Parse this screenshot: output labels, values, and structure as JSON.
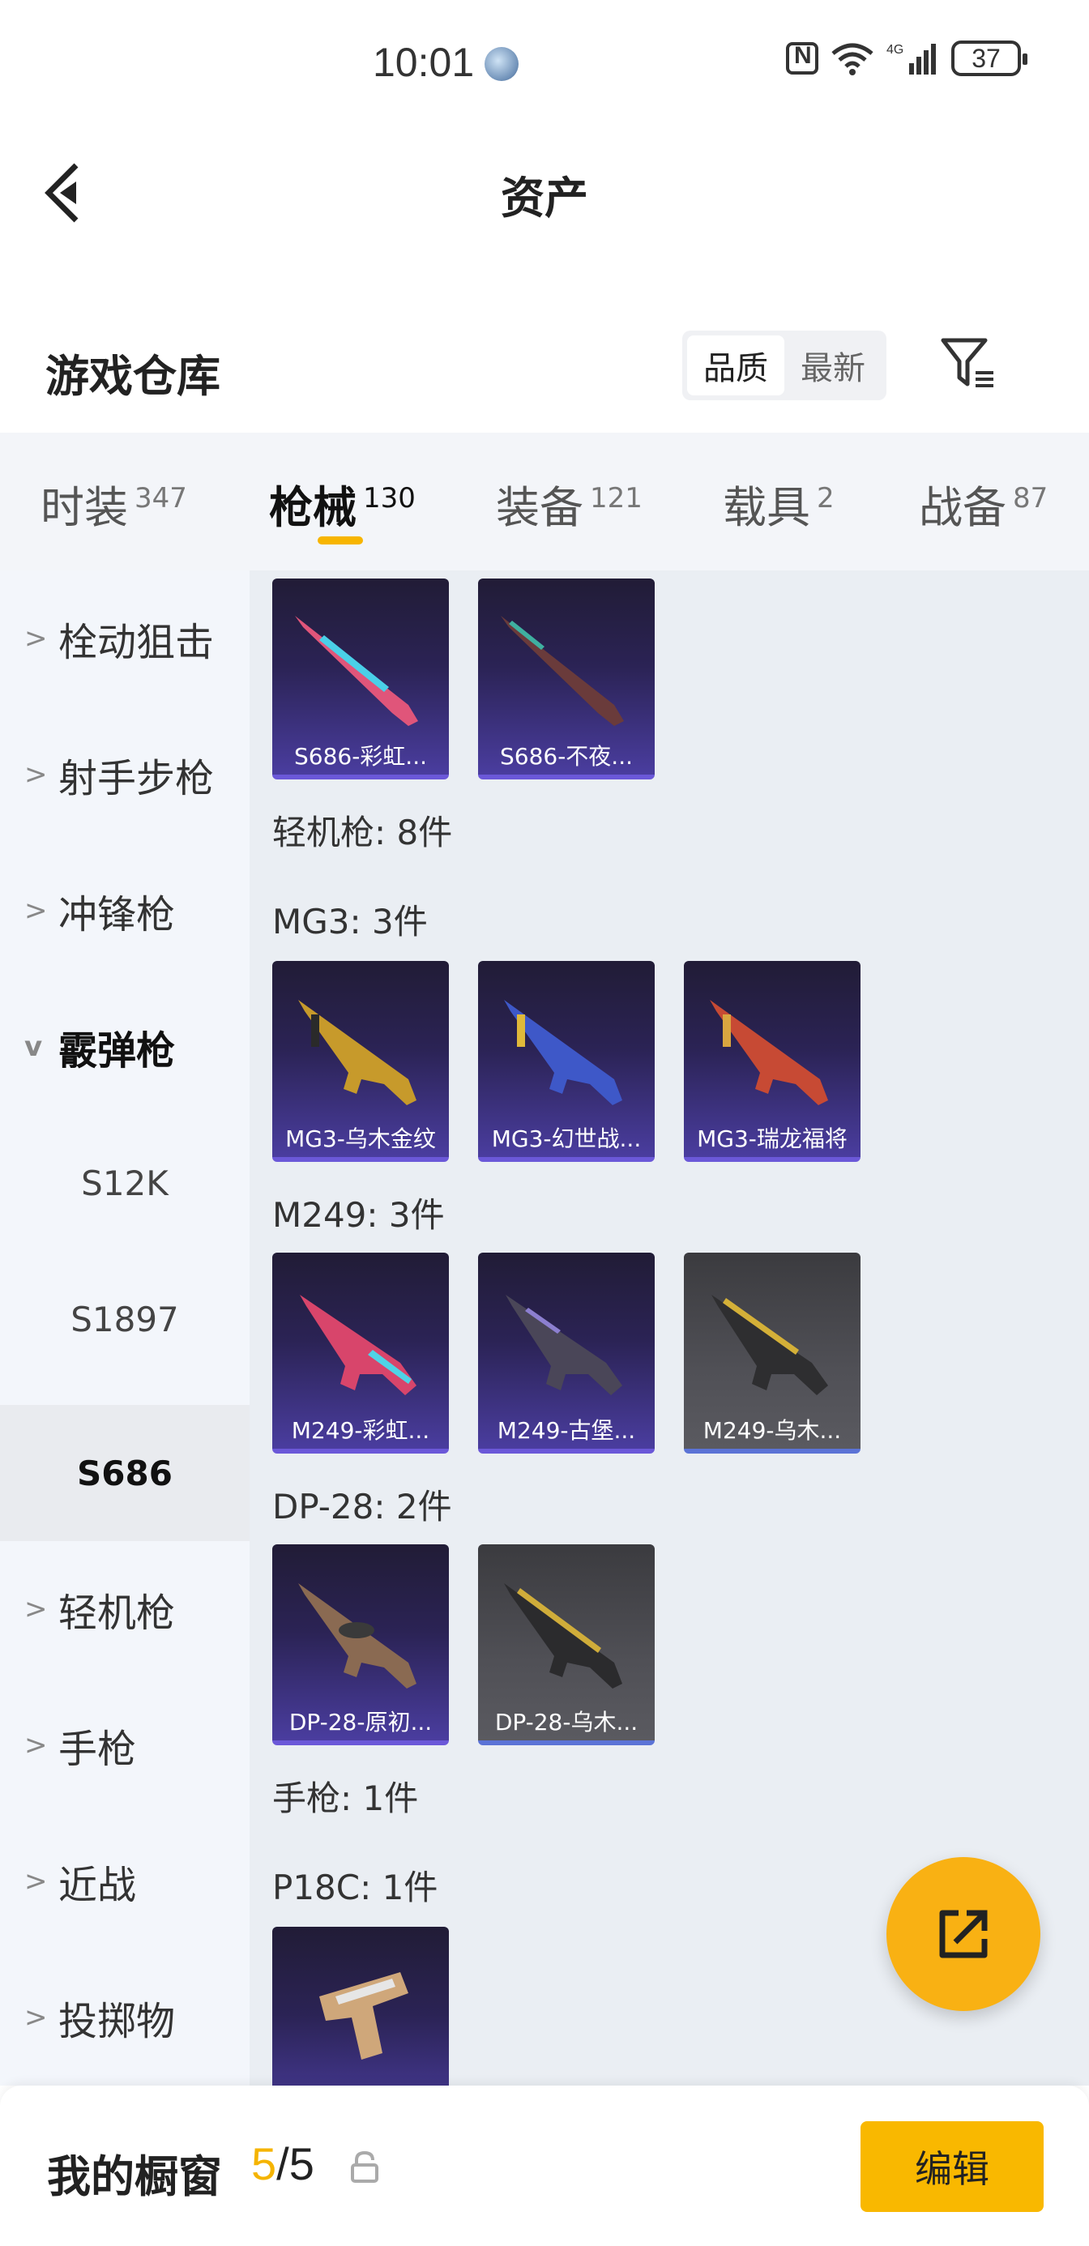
{
  "status_bar": {
    "time": "10:01",
    "network": "4G",
    "wifi_badge": "6",
    "battery": "37"
  },
  "header": {
    "title": "资产"
  },
  "warehouse": {
    "title": "游戏仓库",
    "sort_options": [
      "品质",
      "最新"
    ],
    "active_sort": "品质"
  },
  "tabs": [
    {
      "label": "时装",
      "count": "347"
    },
    {
      "label": "枪械",
      "count": "130"
    },
    {
      "label": "装备",
      "count": "121"
    },
    {
      "label": "载具",
      "count": "2"
    },
    {
      "label": "战备",
      "count": "87"
    }
  ],
  "sidebar": {
    "items": [
      {
        "label": "栓动狙击",
        "chevron": ">"
      },
      {
        "label": "射手步枪",
        "chevron": ">"
      },
      {
        "label": "冲锋枪",
        "chevron": ">"
      },
      {
        "label": "霰弹枪",
        "chevron": "v"
      },
      {
        "label": "S12K"
      },
      {
        "label": "S1897"
      },
      {
        "label": "S686"
      },
      {
        "label": "轻机枪",
        "chevron": ">"
      },
      {
        "label": "手枪",
        "chevron": ">"
      },
      {
        "label": "近战",
        "chevron": ">"
      },
      {
        "label": "投掷物",
        "chevron": ">"
      }
    ]
  },
  "content": {
    "groups": [
      {
        "label": ""
      },
      {
        "label": "轻机枪: 8件"
      },
      {
        "label": "MG3: 3件"
      },
      {
        "label": "M249: 3件"
      },
      {
        "label": "DP-28: 2件"
      },
      {
        "label": "手枪: 1件"
      },
      {
        "label": "P18C: 1件"
      }
    ],
    "cards": [
      {
        "name": "S686-彩虹..."
      },
      {
        "name": "S686-不夜..."
      },
      {
        "name": "MG3-乌木金纹"
      },
      {
        "name": "MG3-幻世战..."
      },
      {
        "name": "MG3-瑞龙福将"
      },
      {
        "name": "M249-彩虹..."
      },
      {
        "name": "M249-古堡..."
      },
      {
        "name": "M249-乌木..."
      },
      {
        "name": "DP-28-原初..."
      },
      {
        "name": "DP-28-乌木..."
      },
      {
        "name": ""
      }
    ]
  },
  "bottom_bar": {
    "label": "我的橱窗",
    "used": "5",
    "total": "/5",
    "edit_label": "编辑"
  },
  "colors": {
    "accent": "#F9B800",
    "card_purple": "#4A3D9F",
    "card_grey": "#505056"
  }
}
